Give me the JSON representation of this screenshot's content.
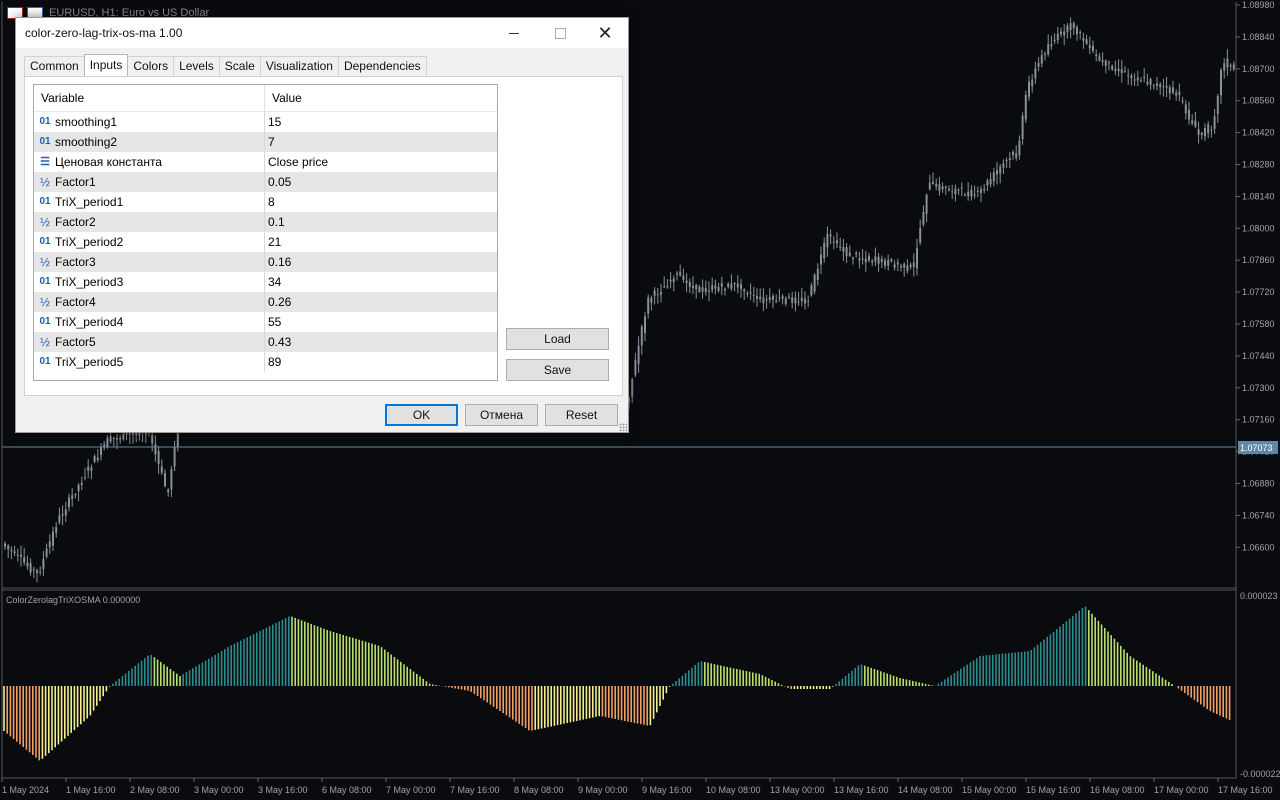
{
  "chart": {
    "symbol_title": "EURUSD, H1:  Euro vs US Dollar",
    "price_ticks": [
      "1.08980",
      "1.08840",
      "1.08700",
      "1.08560",
      "1.08420",
      "1.08280",
      "1.08140",
      "1.08000",
      "1.07860",
      "1.07720",
      "1.07580",
      "1.07440",
      "1.07300",
      "1.07160",
      "1.07020",
      "1.06880",
      "1.06740",
      "1.06600"
    ],
    "current_price": "1.07073",
    "indicator_label": "ColorZerolagTriXOSMA 0.000000",
    "indicator_ticks": [
      "0.000023",
      "-0.000022"
    ],
    "time_ticks": [
      "1 May 2024",
      "1 May 16:00",
      "2 May 08:00",
      "3 May 00:00",
      "3 May 16:00",
      "6 May 08:00",
      "7 May 00:00",
      "7 May 16:00",
      "8 May 08:00",
      "9 May 00:00",
      "9 May 16:00",
      "10 May 08:00",
      "13 May 00:00",
      "13 May 16:00",
      "14 May 08:00",
      "15 May 00:00",
      "15 May 16:00",
      "16 May 08:00",
      "17 May 00:00",
      "17 May 16:00"
    ],
    "colors": {
      "background": "#0a0b0f",
      "candle": "#8b8f96",
      "grid": "#3a3d44",
      "current_line": "#5f87a8",
      "hist_teal": "#2d8a8f",
      "hist_green": "#b8e06a",
      "hist_yellow": "#f2f08a",
      "hist_orange": "#f0a060"
    }
  },
  "dialog": {
    "title": "color-zero-lag-trix-os-ma 1.00",
    "tabs": [
      "Common",
      "Inputs",
      "Colors",
      "Levels",
      "Scale",
      "Visualization",
      "Dependencies"
    ],
    "active_tab": "Inputs",
    "grid": {
      "col_variable": "Variable",
      "col_value": "Value",
      "rows": [
        {
          "type": "int",
          "icon": "01",
          "name": "smoothing1",
          "value": "15"
        },
        {
          "type": "int",
          "icon": "01",
          "name": "smoothing2",
          "value": "7"
        },
        {
          "type": "enum",
          "icon": "☰",
          "name": "Ценовая константа",
          "value": "Close price"
        },
        {
          "type": "double",
          "icon": "½",
          "name": "Factor1",
          "value": "0.05"
        },
        {
          "type": "int",
          "icon": "01",
          "name": "TriX_period1",
          "value": "8"
        },
        {
          "type": "double",
          "icon": "½",
          "name": "Factor2",
          "value": "0.1"
        },
        {
          "type": "int",
          "icon": "01",
          "name": "TriX_period2",
          "value": "21"
        },
        {
          "type": "double",
          "icon": "½",
          "name": "Factor3",
          "value": "0.16"
        },
        {
          "type": "int",
          "icon": "01",
          "name": "TriX_period3",
          "value": "34"
        },
        {
          "type": "double",
          "icon": "½",
          "name": "Factor4",
          "value": "0.26"
        },
        {
          "type": "int",
          "icon": "01",
          "name": "TriX_period4",
          "value": "55"
        },
        {
          "type": "double",
          "icon": "½",
          "name": "Factor5",
          "value": "0.43"
        },
        {
          "type": "int",
          "icon": "01",
          "name": "TriX_period5",
          "value": "89"
        }
      ]
    },
    "buttons": {
      "load": "Load",
      "save": "Save",
      "ok": "OK",
      "cancel": "Отмена",
      "reset": "Reset"
    }
  }
}
